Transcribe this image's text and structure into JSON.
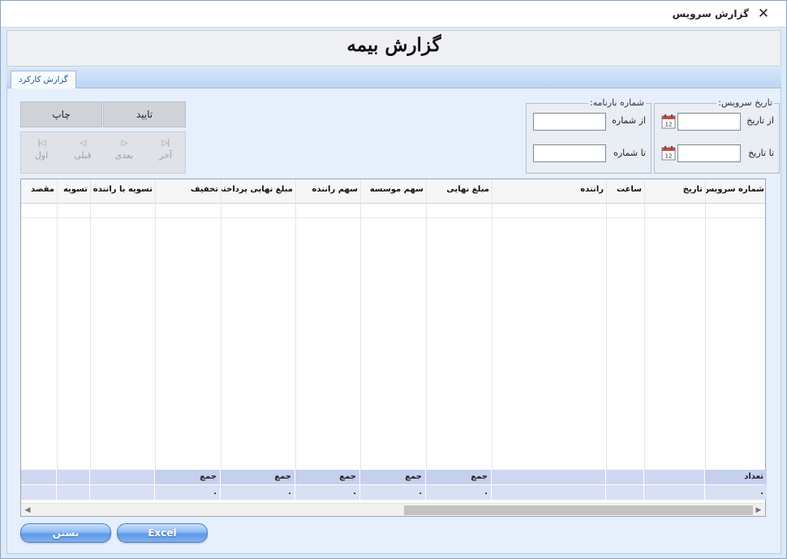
{
  "window": {
    "title": "گزارش سرویس",
    "close_icon": "close-icon"
  },
  "page": {
    "title": "گزارش بیمه"
  },
  "tabs": [
    {
      "label": "گزارش کارکرد",
      "active": true
    }
  ],
  "actions": {
    "confirm_label": "تایید",
    "print_label": "چاپ"
  },
  "navigation": {
    "last": "آخر",
    "next": "بعدی",
    "previous": "قبلی",
    "first": "اول",
    "enabled": false
  },
  "filters": {
    "service_date": {
      "legend": "تاریخ سرویس:",
      "from_label": "از تاریخ",
      "to_label": "تا تاریخ",
      "from_value": "",
      "to_value": ""
    },
    "waybill_number": {
      "legend": "شماره بارنامه:",
      "from_label": "از شماره",
      "to_label": "تا شماره",
      "from_value": "",
      "to_value": ""
    }
  },
  "grid": {
    "columns": [
      "شماره سرویس",
      "تاریخ",
      "ساعت",
      "راننده",
      "مبلغ نهایی",
      "سهم موسسه",
      "سهم راننده",
      "مبلغ نهایی پرداختی",
      "تخفیف",
      "تسویه با راننده",
      "تسویه",
      "مقصد"
    ],
    "rows": [],
    "footer": {
      "count_label": "تعداد",
      "sum_label": "جمع",
      "count_value": ".",
      "sum_value": "."
    }
  },
  "buttons": {
    "excel_label": "Excel",
    "close_label": "بستن"
  },
  "colors": {
    "footer_header": "#c5d0ee",
    "footer_values": "#d9dff5",
    "glossy_button": "#6aa2ea",
    "tab_text": "#1f4a8a"
  }
}
